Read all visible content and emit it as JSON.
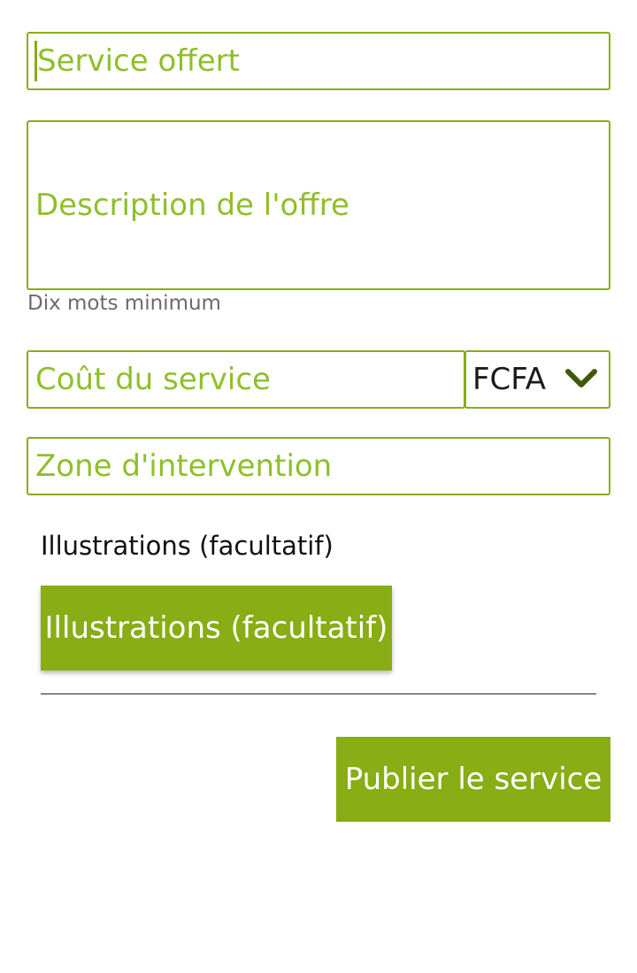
{
  "colors": {
    "accent": "#88ad15",
    "placeholder": "#8fbf2a",
    "helper_text": "#6b6b6b"
  },
  "form": {
    "service": {
      "placeholder": "Service offert",
      "value": ""
    },
    "description": {
      "placeholder": "Description de l'offre",
      "value": "",
      "helper": "Dix mots minimum"
    },
    "cost": {
      "placeholder": "Coût du service",
      "value": ""
    },
    "currency": {
      "selected": "FCFA",
      "icon": "chevron-down-icon"
    },
    "zone": {
      "placeholder": "Zone d'intervention",
      "value": ""
    },
    "illustrations": {
      "label": "Illustrations (facultatif)",
      "button_label": "Illustrations (facultatif)"
    },
    "publish_label": "Publier le service"
  }
}
